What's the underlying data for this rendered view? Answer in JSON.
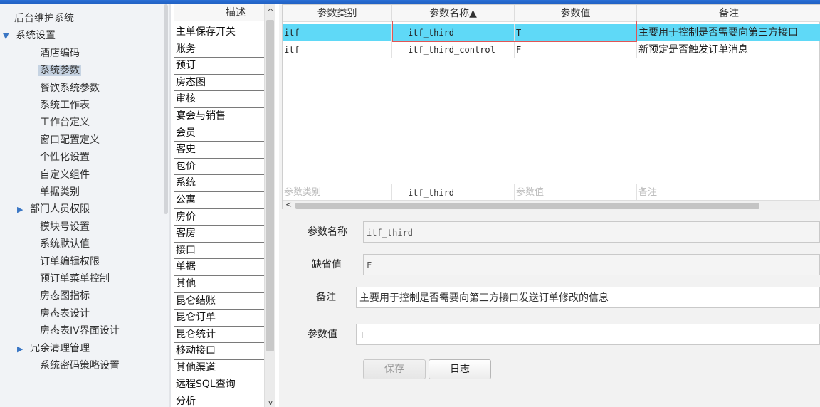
{
  "nav": {
    "items": [
      {
        "label": "后台维护系统",
        "level": 0,
        "expander": ""
      },
      {
        "label": "系统设置",
        "level": 0,
        "expander": "▼"
      },
      {
        "label": "酒店编码",
        "level": 2,
        "expander": ""
      },
      {
        "label": "系统参数",
        "level": 2,
        "expander": "",
        "selected": true
      },
      {
        "label": "餐饮系统参数",
        "level": 2,
        "expander": ""
      },
      {
        "label": "系统工作表",
        "level": 2,
        "expander": ""
      },
      {
        "label": "工作台定义",
        "level": 2,
        "expander": ""
      },
      {
        "label": "窗口配置定义",
        "level": 2,
        "expander": ""
      },
      {
        "label": "个性化设置",
        "level": 2,
        "expander": ""
      },
      {
        "label": "自定义组件",
        "level": 2,
        "expander": ""
      },
      {
        "label": "单据类别",
        "level": 2,
        "expander": ""
      },
      {
        "label": "部门人员权限",
        "level": 1,
        "expander": "▶"
      },
      {
        "label": "模块号设置",
        "level": 2,
        "expander": ""
      },
      {
        "label": "系统默认值",
        "level": 2,
        "expander": ""
      },
      {
        "label": "订单编辑权限",
        "level": 2,
        "expander": ""
      },
      {
        "label": "预订单菜单控制",
        "level": 2,
        "expander": ""
      },
      {
        "label": "房态图指标",
        "level": 2,
        "expander": ""
      },
      {
        "label": "房态表设计",
        "level": 2,
        "expander": ""
      },
      {
        "label": "房态表IV界面设计",
        "level": 2,
        "expander": ""
      },
      {
        "label": "冗余清理管理",
        "level": 1,
        "expander": "▶"
      },
      {
        "label": "系统密码策略设置",
        "level": 2,
        "expander": ""
      }
    ]
  },
  "desc": {
    "header": "描述",
    "scroll_up": "^",
    "scroll_down": "v",
    "items": [
      "主单保存开关",
      "账务",
      "预订",
      "房态图",
      "审核",
      "宴会与销售",
      "会员",
      "客史",
      "包价",
      "系统",
      "公寓",
      "房价",
      "客房",
      "接口",
      "单据",
      "其他",
      "昆仑结账",
      "昆仑订单",
      "昆仑统计",
      "移动接口",
      "其他渠道",
      "远程SQL查询",
      "分析"
    ]
  },
  "grid": {
    "columns": [
      "参数类别",
      "参数名称▲",
      "参数值",
      "备注"
    ],
    "rows": [
      {
        "category": "itf",
        "name": "itf_third",
        "value": "T",
        "remark": "主要用于控制是否需要向第三方接口",
        "selected": true
      },
      {
        "category": "itf",
        "name": "itf_third_control",
        "value": "F",
        "remark": "新预定是否触发订单消息",
        "selected": false
      }
    ],
    "filter": {
      "category": "参数类别",
      "name": "itf_third",
      "value": "参数值",
      "remark": "备注"
    },
    "scroll_left": "<"
  },
  "form": {
    "name_label": "参数名称",
    "name_value": "itf_third",
    "default_label": "缺省值",
    "default_value": "F",
    "remark_label": "备注",
    "remark_value": "主要用于控制是否需要向第三方接口发送订单修改的信息",
    "value_label": "参数值",
    "value_value": "T",
    "save_label": "保存",
    "log_label": "日志"
  },
  "colors": {
    "selected_row": "#5fd9f7",
    "highlight_box": "#e25555",
    "nav_selected": "#c6d3e2",
    "topbar": "#2a6fd6"
  }
}
